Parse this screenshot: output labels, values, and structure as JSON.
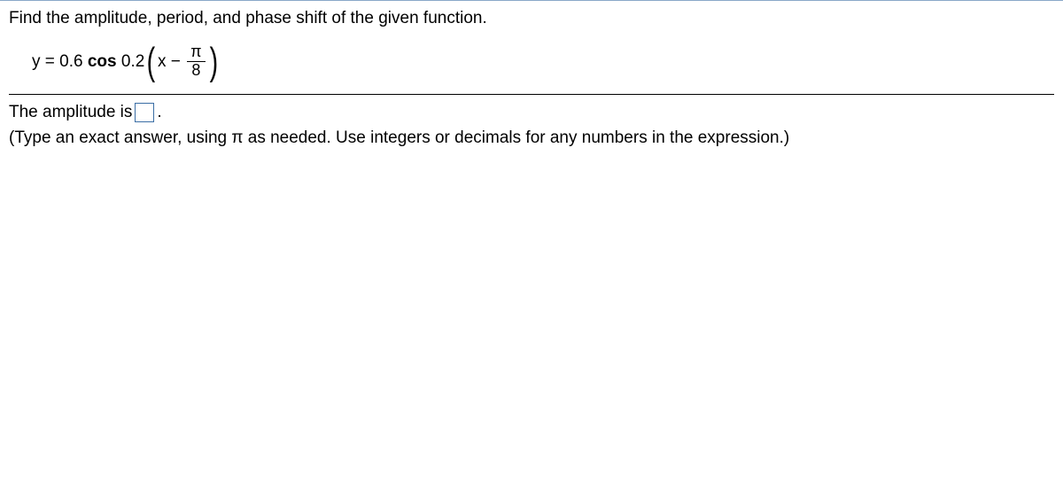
{
  "instruction": "Find the amplitude, period, and phase shift of the given function.",
  "equation": {
    "lhs": "y = 0.6 ",
    "func": "cos",
    "coef": " 0.2",
    "inner_lead": "x − ",
    "frac_num": "π",
    "frac_den": "8"
  },
  "answer": {
    "prefix": "The amplitude is ",
    "suffix": "."
  },
  "hint": "(Type an exact answer, using π as needed. Use integers or decimals for any numbers in the expression.)"
}
